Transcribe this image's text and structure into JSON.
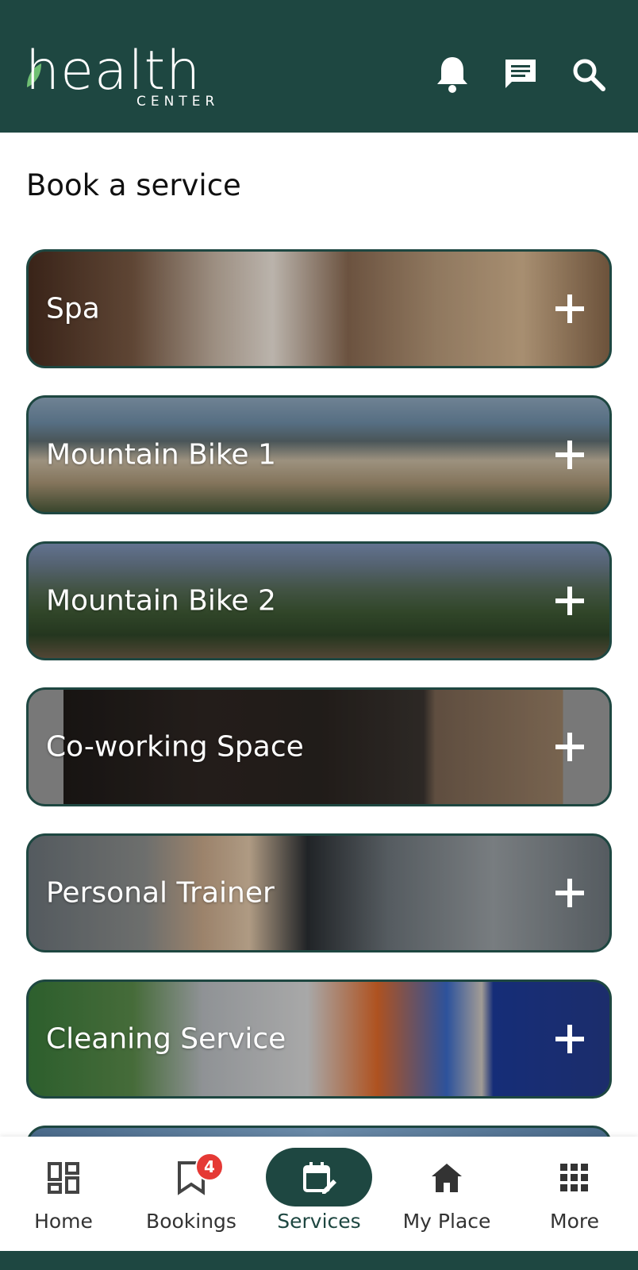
{
  "header": {
    "logo_word": "health",
    "logo_sub": "CENTER",
    "icons": [
      "bell-icon",
      "chat-icon",
      "search-icon"
    ]
  },
  "page": {
    "title": "Book a service"
  },
  "services": [
    {
      "label": "Spa"
    },
    {
      "label": "Mountain Bike 1"
    },
    {
      "label": "Mountain Bike 2"
    },
    {
      "label": "Co-working Space"
    },
    {
      "label": "Personal Trainer"
    },
    {
      "label": "Cleaning Service"
    }
  ],
  "nav": {
    "items": [
      {
        "label": "Home",
        "icon": "dashboard-icon"
      },
      {
        "label": "Bookings",
        "icon": "bookmark-icon",
        "badge": "4"
      },
      {
        "label": "Services",
        "icon": "calendar-edit-icon",
        "active": true
      },
      {
        "label": "My Place",
        "icon": "home-icon"
      },
      {
        "label": "More",
        "icon": "apps-grid-icon"
      }
    ]
  },
  "colors": {
    "brand": "#1e4741",
    "badge": "#e53935"
  }
}
